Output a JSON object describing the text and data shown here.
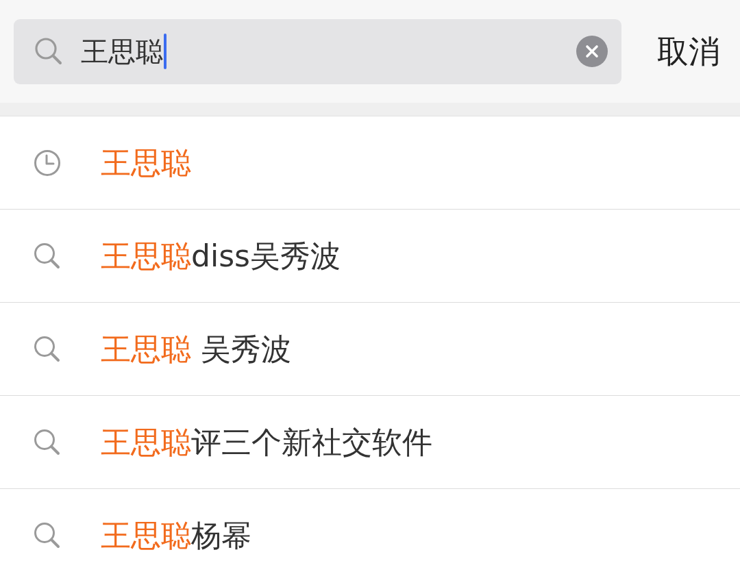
{
  "search": {
    "value": "王思聪",
    "focused": true
  },
  "cancel_button": "取消",
  "suggestions": [
    {
      "kind": "history",
      "match": "王思聪"
    },
    {
      "kind": "query",
      "match": "王思聪",
      "rest": "diss吴秀波"
    },
    {
      "kind": "query",
      "match": "王思聪",
      "rest": " 吴秀波"
    },
    {
      "kind": "query",
      "match": "王思聪",
      "rest": "评三个新社交软件"
    },
    {
      "kind": "query",
      "match": "王思聪",
      "rest": "杨幂"
    }
  ]
}
